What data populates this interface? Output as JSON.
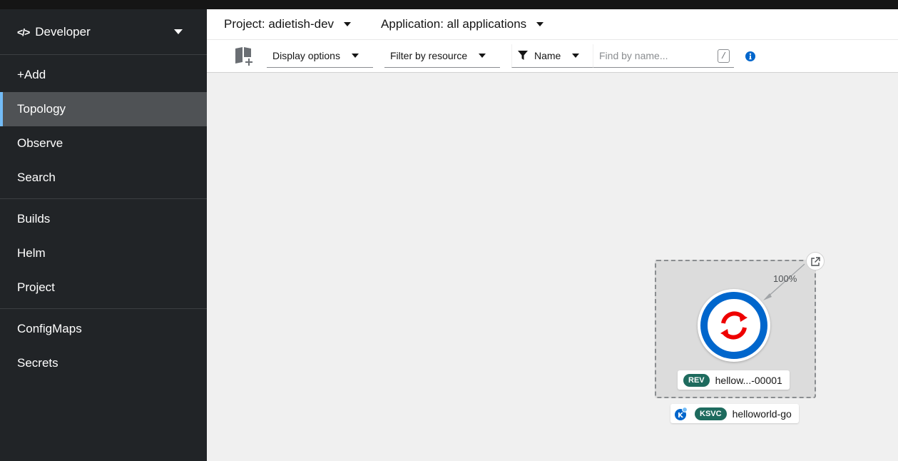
{
  "perspective": {
    "code_icon": "</>",
    "label": "Developer"
  },
  "nav": {
    "groups": [
      [
        "+Add",
        "Topology",
        "Observe",
        "Search"
      ],
      [
        "Builds",
        "Helm",
        "Project"
      ],
      [
        "ConfigMaps",
        "Secrets"
      ]
    ],
    "active": "Topology"
  },
  "header": {
    "project_label": "Project: adietish-dev",
    "application_label": "Application: all applications"
  },
  "toolbar": {
    "display_options": "Display options",
    "filter_by_resource": "Filter by resource",
    "filter_type": "Name",
    "search_placeholder": "Find by name...",
    "shortcut_key": "/"
  },
  "topology": {
    "traffic_percent": "100%",
    "revision_badge": "REV",
    "revision_name": "hellow...-00001",
    "service_badge": "KSVC",
    "service_name": "helloworld-go"
  },
  "colors": {
    "accent_blue": "#0066cc",
    "openshift_red": "#ee0000",
    "active_nav_border": "#73bcf7",
    "badge_green": "#1e6b5e"
  }
}
